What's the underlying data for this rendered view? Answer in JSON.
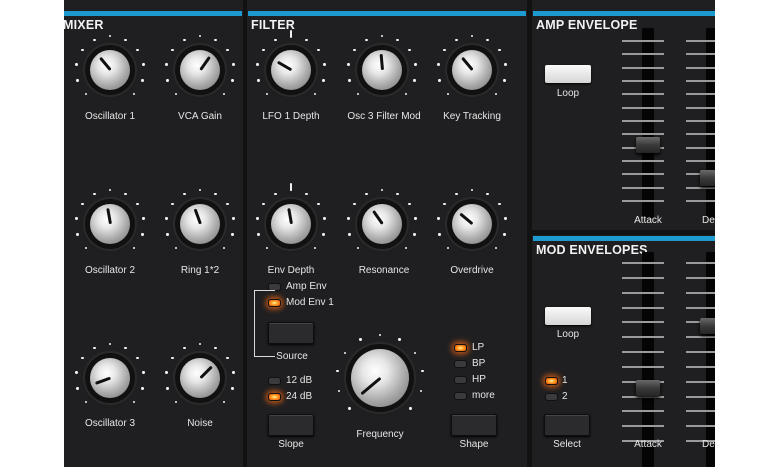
{
  "sections": {
    "mixer": "MIXER",
    "filter": "FILTER",
    "amp_envelope": "AMP ENVELOPE",
    "mod_envelopes": "MOD ENVELOPES"
  },
  "mixer": {
    "knobs": [
      "Oscillator 1",
      "VCA Gain",
      "Oscillator 2",
      "Ring 1*2",
      "Oscillator 3",
      "Noise"
    ]
  },
  "filter": {
    "knobs": [
      "LFO 1 Depth",
      "Osc 3 Filter Mod",
      "Key Tracking",
      "Env Depth",
      "Resonance",
      "Overdrive"
    ],
    "frequency_label": "Frequency",
    "source": {
      "options": [
        "Amp Env",
        "Mod Env 1"
      ],
      "active": "Mod Env 1",
      "label": "Source"
    },
    "slope": {
      "options": [
        "12 dB",
        "24 dB"
      ],
      "active": "24 dB",
      "label": "Slope"
    },
    "shape": {
      "options": [
        "LP",
        "BP",
        "HP",
        "more"
      ],
      "active": "LP",
      "label": "Shape"
    }
  },
  "amp_envelope": {
    "loop_label": "Loop",
    "attack_label": "Attack",
    "decay_label": "Dec"
  },
  "mod_envelopes": {
    "loop_label": "Loop",
    "select": {
      "options": [
        "1",
        "2"
      ],
      "active": "1",
      "label": "Select"
    },
    "attack_label": "Attack",
    "decay_label": "Dec"
  },
  "colors": {
    "accent_bar": "#1d9bd1",
    "panel": "#1f1f21",
    "led_on": "#ff9a1f"
  }
}
